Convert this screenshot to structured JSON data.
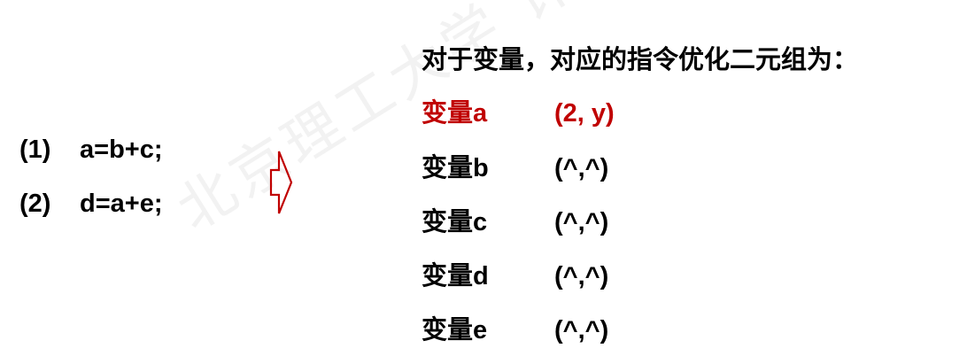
{
  "watermark": "北京理工大学 计算机学院",
  "code": [
    {
      "num": "(1)",
      "stmt": "a=b+c;"
    },
    {
      "num": "(2)",
      "stmt": "d=a+e;"
    }
  ],
  "title": "对于变量，对应的指令优化二元组为：",
  "vars": [
    {
      "name": "变量a",
      "tuple": "(2, y)"
    },
    {
      "name": "变量b",
      "tuple": "(^,^)"
    },
    {
      "name": "变量c",
      "tuple": "(^,^)"
    },
    {
      "name": "变量d",
      "tuple": "(^,^)"
    },
    {
      "name": "变量e",
      "tuple": "(^,^)"
    }
  ],
  "colors": {
    "highlight": "#c00000",
    "arrow_stroke": "#c00000",
    "text": "#000000"
  },
  "icons": {
    "arrow": "right-arrow-outline-icon"
  }
}
